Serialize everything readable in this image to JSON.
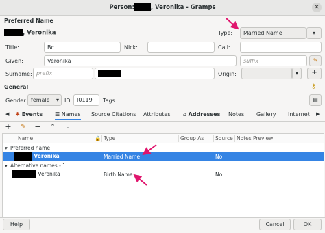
{
  "window": {
    "title_pre": "Person:",
    "title_post": ", Veronika - Gramps",
    "close_glyph": "✕"
  },
  "preferred": {
    "section_title": "Preferred Name",
    "display_name": ", Veronika",
    "type_label": "Type:",
    "type_value": "Married Name",
    "title_label": "Title:",
    "title_value": "Bc",
    "nick_label": "Nick:",
    "nick_value": "",
    "call_label": "Call:",
    "call_value": "",
    "given_label": "Given:",
    "given_value": "Veronika",
    "suffix_placeholder": "suffix",
    "surname_label": "Surname:",
    "prefix_placeholder": "prefix",
    "origin_label": "Origin:",
    "origin_value": ""
  },
  "general": {
    "section_title": "General",
    "gender_label": "Gender:",
    "gender_value": "female",
    "id_label": "ID:",
    "id_value": "I0119",
    "tags_label": "Tags:",
    "tags_value": ""
  },
  "tabs": [
    "Events",
    "Names",
    "Source Citations",
    "Attributes",
    "Addresses",
    "Notes",
    "Gallery",
    "Internet"
  ],
  "table": {
    "columns": [
      "Name",
      "Type",
      "Group As",
      "Source",
      "Notes Preview"
    ],
    "group_preferred": "Preferred name",
    "group_alternative": "Alternative names - 1",
    "rows": [
      {
        "name": "Veronika",
        "type": "Married Name",
        "group_as": "",
        "source": "No",
        "notes": ""
      },
      {
        "name": "Veronika",
        "type": "Birth Name",
        "group_as": "",
        "source": "No",
        "notes": ""
      }
    ]
  },
  "footer": {
    "help": "Help",
    "cancel": "Cancel",
    "ok": "OK"
  },
  "colors": {
    "accent": "#3584e4",
    "arrow": "#e0156d"
  }
}
